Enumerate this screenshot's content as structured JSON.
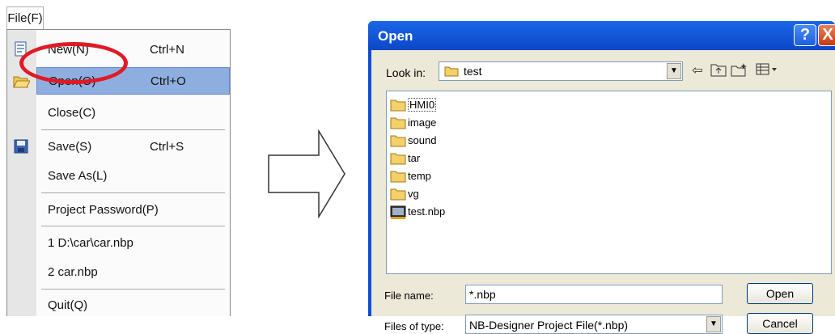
{
  "menu": {
    "tab_label": "File(F)",
    "items": [
      {
        "label": "New(N)",
        "shortcut": "Ctrl+N",
        "icon": "new-file-icon"
      },
      {
        "label": "Open(O)",
        "shortcut": "Ctrl+O",
        "icon": "open-folder-icon"
      },
      {
        "label": "Close(C)",
        "shortcut": ""
      },
      {
        "label": "Save(S)",
        "shortcut": "Ctrl+S",
        "icon": "save-icon"
      },
      {
        "label": "Save As(L)",
        "shortcut": ""
      },
      {
        "label": "Project Password(P)",
        "shortcut": ""
      },
      {
        "label": "1 D:\\car\\car.nbp",
        "shortcut": ""
      },
      {
        "label": "2 car.nbp",
        "shortcut": ""
      },
      {
        "label": "Quit(Q)",
        "shortcut": ""
      }
    ],
    "highlight_color": "#8faee0",
    "annotation_color": "#e01a24"
  },
  "dialog": {
    "title": "Open",
    "help_label": "?",
    "close_label": "X",
    "look_in_label": "Look in:",
    "look_in_value": "test",
    "files": [
      {
        "name": "HMI0",
        "type": "folder"
      },
      {
        "name": "image",
        "type": "folder"
      },
      {
        "name": "sound",
        "type": "folder"
      },
      {
        "name": "tar",
        "type": "folder"
      },
      {
        "name": "temp",
        "type": "folder"
      },
      {
        "name": "vg",
        "type": "folder"
      },
      {
        "name": "test.nbp",
        "type": "project-file"
      }
    ],
    "file_name_label": "File name:",
    "file_name_value": "*.nbp",
    "files_of_type_label": "Files of type:",
    "files_of_type_value": "NB-Designer Project File(*.nbp)",
    "open_button": "Open",
    "cancel_button": "Cancel",
    "titlebar_color": "#0c4fd6"
  }
}
